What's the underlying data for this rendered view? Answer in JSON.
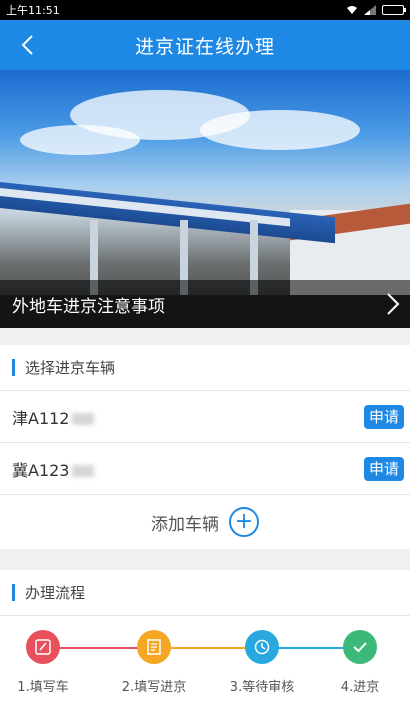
{
  "status_bar": {
    "time": "上午11:51"
  },
  "app_bar": {
    "title": "进京证在线办理"
  },
  "banner": {
    "caption": "外地车进京注意事项"
  },
  "vehicles_section": {
    "heading": "选择进京车辆",
    "vehicles": [
      {
        "plate": "津A112",
        "action": "申请"
      },
      {
        "plate": "冀A123",
        "action": "申请"
      }
    ],
    "add_label": "添加车辆"
  },
  "process_section": {
    "heading": "办理流程",
    "steps": [
      {
        "label": "1.填写车",
        "color": "#e8505b",
        "icon": "edit-icon"
      },
      {
        "label": "2.填写进京",
        "color": "#f5a623",
        "icon": "document-icon"
      },
      {
        "label": "3.等待审核",
        "color": "#29a8e0",
        "icon": "clock-icon"
      },
      {
        "label": "4.进京",
        "color": "#3cb878",
        "icon": "check-icon"
      }
    ]
  },
  "colors": {
    "accent": "#1e88e5"
  }
}
